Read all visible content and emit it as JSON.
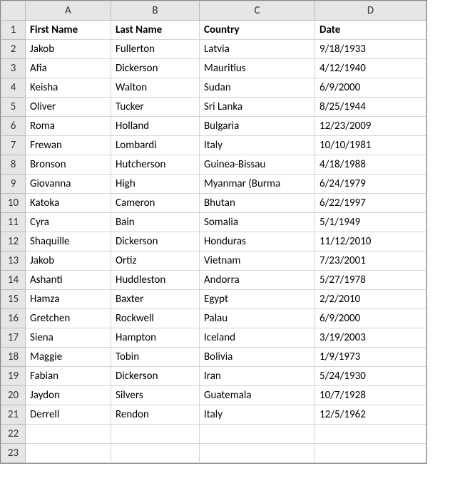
{
  "columns": [
    "A",
    "B",
    "C",
    "D"
  ],
  "header_row": {
    "row_num": 1,
    "cells": [
      "First Name",
      "Last Name",
      "Country",
      "Date"
    ]
  },
  "data_rows": [
    {
      "row_num": 2,
      "cells": [
        "Jakob",
        "Fullerton",
        "Latvia",
        "9/18/1933"
      ]
    },
    {
      "row_num": 3,
      "cells": [
        "Afia",
        "Dickerson",
        "Mauritius",
        "4/12/1940"
      ]
    },
    {
      "row_num": 4,
      "cells": [
        "Keisha",
        "Walton",
        "Sudan",
        "6/9/2000"
      ]
    },
    {
      "row_num": 5,
      "cells": [
        "Oliver",
        "Tucker",
        "Sri Lanka",
        "8/25/1944"
      ]
    },
    {
      "row_num": 6,
      "cells": [
        "Roma",
        "Holland",
        "Bulgaria",
        "12/23/2009"
      ]
    },
    {
      "row_num": 7,
      "cells": [
        "Frewan",
        "Lombardi",
        "Italy",
        "10/10/1981"
      ]
    },
    {
      "row_num": 8,
      "cells": [
        "Bronson",
        "Hutcherson",
        "Guinea-Bissau",
        "4/18/1988"
      ]
    },
    {
      "row_num": 9,
      "cells": [
        "Giovanna",
        "High",
        "Myanmar (Burma",
        "6/24/1979"
      ]
    },
    {
      "row_num": 10,
      "cells": [
        "Katoka",
        "Cameron",
        "Bhutan",
        "6/22/1997"
      ]
    },
    {
      "row_num": 11,
      "cells": [
        "Cyra",
        "Bain",
        "Somalia",
        "5/1/1949"
      ]
    },
    {
      "row_num": 12,
      "cells": [
        "Shaquille",
        "Dickerson",
        "Honduras",
        "11/12/2010"
      ]
    },
    {
      "row_num": 13,
      "cells": [
        "Jakob",
        "Ortiz",
        "Vietnam",
        "7/23/2001"
      ]
    },
    {
      "row_num": 14,
      "cells": [
        "Ashanti",
        "Huddleston",
        "Andorra",
        "5/27/1978"
      ]
    },
    {
      "row_num": 15,
      "cells": [
        "Hamza",
        "Baxter",
        "Egypt",
        "2/2/2010"
      ]
    },
    {
      "row_num": 16,
      "cells": [
        "Gretchen",
        "Rockwell",
        "Palau",
        "6/9/2000"
      ]
    },
    {
      "row_num": 17,
      "cells": [
        "Siena",
        "Hampton",
        "Iceland",
        "3/19/2003"
      ]
    },
    {
      "row_num": 18,
      "cells": [
        "Maggie",
        "Tobin",
        "Bolivia",
        "1/9/1973"
      ]
    },
    {
      "row_num": 19,
      "cells": [
        "Fabian",
        "Dickerson",
        "Iran",
        "5/24/1930"
      ]
    },
    {
      "row_num": 20,
      "cells": [
        "Jaydon",
        "Silvers",
        "Guatemala",
        "10/7/1928"
      ]
    },
    {
      "row_num": 21,
      "cells": [
        "Derrell",
        "Rendon",
        "Italy",
        "12/5/1962"
      ]
    }
  ],
  "empty_rows": [
    22,
    23
  ]
}
